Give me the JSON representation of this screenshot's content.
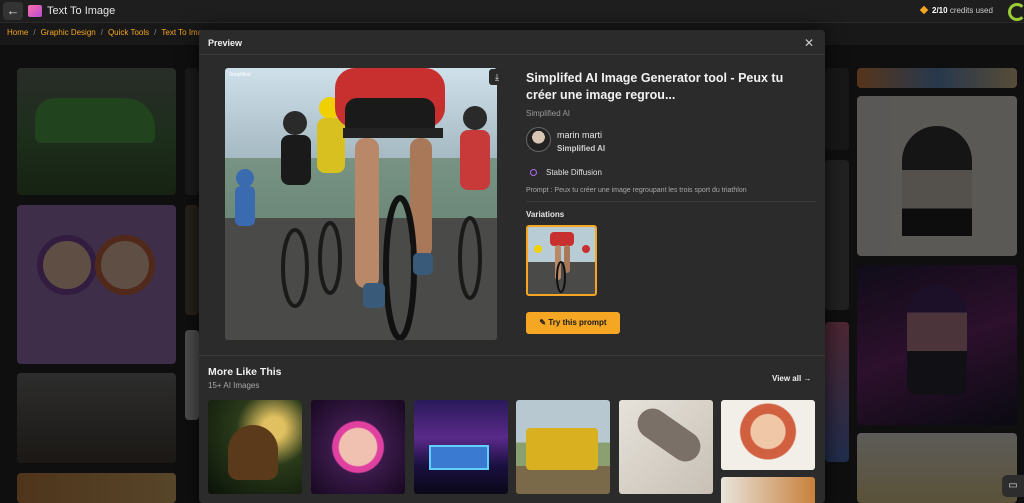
{
  "app": {
    "title": "Text To Image"
  },
  "credits": {
    "used": "2/10",
    "label": "credits used"
  },
  "breadcrumb": [
    "Home",
    "Graphic Design",
    "Quick Tools",
    "Text To Image"
  ],
  "modal": {
    "title": "Preview",
    "image_watermark": "Simplified",
    "image_title": "Simplifed AI Image Generator tool - Peux tu créer une image regrou...",
    "source": "Simplified AI",
    "author": {
      "name": "marin marti",
      "org": "Simplified AI"
    },
    "model": "Stable Diffusion",
    "prompt": "Prompt : Peux tu créer une image regroupant les trois sport du triathlon",
    "variations_label": "Variations",
    "try_button": "Try this prompt"
  },
  "more_like_this": {
    "title": "More Like This",
    "count": "15+ AI Images",
    "view_all": "View all"
  },
  "icons": {
    "back": "arrow-left-icon",
    "close": "close-icon",
    "download": "download-icon",
    "try": "pencil-icon",
    "view_all": "arrow-right-icon",
    "chat": "chat-icon"
  },
  "colors": {
    "accent": "#f5a623",
    "modal_bg": "#2b2b2b",
    "page_bg": "#181818"
  }
}
